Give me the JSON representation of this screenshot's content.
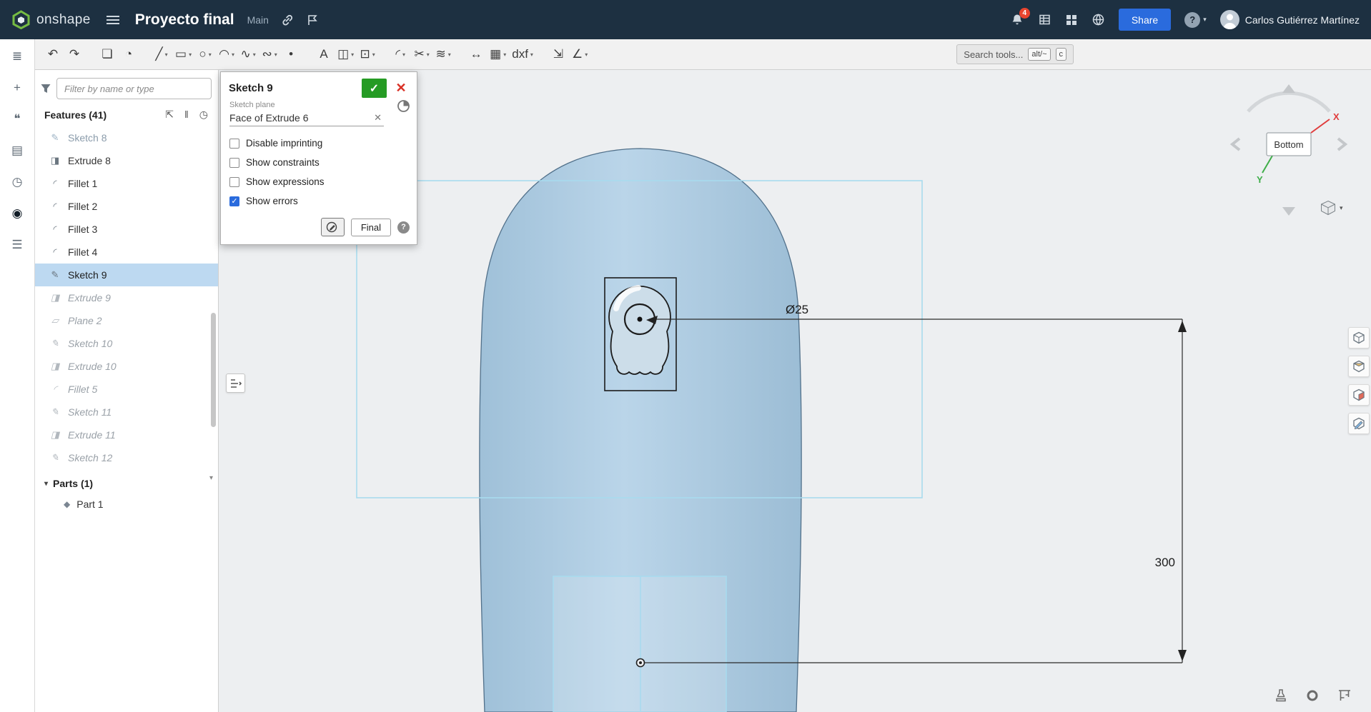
{
  "icons": {
    "caret": "▾",
    "check": "✓",
    "close": "✕",
    "hamburger": "☰",
    "question": "?"
  },
  "colors": {
    "topbar_bg": "#1d3041",
    "accent_blue": "#2a6bdd",
    "selection_blue": "#bdd9f1",
    "part_blue": "#aac9df",
    "sketch_line_blue": "#a8dbee",
    "success_green": "#259b24",
    "error_red": "#d93025",
    "logo_green": "#76bc43",
    "axis_x_red": "#e03c3c",
    "axis_y_green": "#3fae49"
  },
  "topbar": {
    "logo_text": "onshape",
    "document_title": "Proyecto final",
    "workspace_label": "Main",
    "notification_count": "4",
    "share_button": "Share",
    "user_name": "Carlos Gutiérrez Martínez"
  },
  "toolbar": {
    "search_text": "Search tools...",
    "kbd_alt": "alt/~",
    "kbd_c": "c",
    "items": [
      {
        "name": "undo-icon",
        "glyph": "↶"
      },
      {
        "name": "redo-icon",
        "glyph": "↷"
      },
      {
        "name": "paste-sketch-icon",
        "glyph": "❏",
        "cls": "gap"
      },
      {
        "name": "sketch-region-icon",
        "glyph": "◔"
      },
      {
        "name": "line-tool-icon",
        "glyph": "╱",
        "dd": true,
        "cls": "gap"
      },
      {
        "name": "rectangle-tool-icon",
        "glyph": "▭",
        "dd": true
      },
      {
        "name": "circle-tool-icon",
        "glyph": "○",
        "dd": true
      },
      {
        "name": "arc-tool-icon",
        "glyph": "◠",
        "dd": true
      },
      {
        "name": "spline-tool-icon",
        "glyph": "∿",
        "dd": true
      },
      {
        "name": "conic-tool-icon",
        "glyph": "∾",
        "dd": true
      },
      {
        "name": "point-tool-icon",
        "glyph": "•"
      },
      {
        "name": "text-tool-icon",
        "glyph": "A",
        "cls": "gap"
      },
      {
        "name": "mirror-tool-icon",
        "glyph": "◫",
        "dd": true
      },
      {
        "name": "project-convert-icon",
        "glyph": "⊡",
        "dd": true
      },
      {
        "name": "fillet-tool-icon",
        "glyph": "◜",
        "dd": true,
        "cls": "gap"
      },
      {
        "name": "trim-tool-icon",
        "glyph": "✂",
        "dd": true
      },
      {
        "name": "offset-tool-icon",
        "glyph": "≋",
        "dd": true
      },
      {
        "name": "dimension-tool-icon",
        "glyph": "↔",
        "cls": "gap"
      },
      {
        "name": "pattern-tool-icon",
        "glyph": "▦",
        "dd": true
      },
      {
        "name": "export-dxf-icon",
        "glyph": "dxf",
        "dd": true
      },
      {
        "name": "transform-tool-icon",
        "glyph": "⇲",
        "cls": "gap"
      },
      {
        "name": "measure-angle-icon",
        "glyph": "∠",
        "dd": true
      }
    ]
  },
  "left_strip": {
    "icons": [
      {
        "name": "features-panel-icon",
        "glyph": "≣"
      },
      {
        "name": "insert-panel-icon",
        "glyph": "+"
      },
      {
        "name": "comments-panel-icon",
        "glyph": "❝"
      },
      {
        "name": "notes-panel-icon",
        "glyph": "▤"
      },
      {
        "name": "history-panel-icon",
        "glyph": "◷"
      },
      {
        "name": "search-panel-icon",
        "glyph": "◉",
        "cls": "active"
      },
      {
        "name": "outline-panel-icon",
        "glyph": "☰"
      }
    ]
  },
  "sidebar": {
    "filter_placeholder": "Filter by name or type",
    "features_header": "Features (41)",
    "header_icons": [
      {
        "name": "final-marker-icon",
        "glyph": "⇱"
      },
      {
        "name": "suppress-icon",
        "glyph": "‖"
      },
      {
        "name": "history-icon",
        "glyph": "◷"
      }
    ],
    "features": [
      {
        "label": "Sketch 8",
        "icon": "sketch-icon",
        "glyph": "✎",
        "state": "dim"
      },
      {
        "label": "Extrude 8",
        "icon": "extrude-icon",
        "glyph": "◨",
        "state": "normal"
      },
      {
        "label": "Fillet 1",
        "icon": "fillet-icon",
        "glyph": "◜",
        "state": "normal"
      },
      {
        "label": "Fillet 2",
        "icon": "fillet-icon",
        "glyph": "◜",
        "state": "normal"
      },
      {
        "label": "Fillet 3",
        "icon": "fillet-icon",
        "glyph": "◜",
        "state": "normal"
      },
      {
        "label": "Fillet 4",
        "icon": "fillet-icon",
        "glyph": "◜",
        "state": "normal"
      },
      {
        "label": "Sketch 9",
        "icon": "sketch-icon",
        "glyph": "✎",
        "state": "selected"
      },
      {
        "label": "Extrude 9",
        "icon": "extrude-icon",
        "glyph": "◨",
        "state": "ghost"
      },
      {
        "label": "Plane 2",
        "icon": "plane-icon",
        "glyph": "▱",
        "state": "ghost"
      },
      {
        "label": "Sketch 10",
        "icon": "sketch-icon",
        "glyph": "✎",
        "state": "ghost"
      },
      {
        "label": "Extrude 10",
        "icon": "extrude-icon",
        "glyph": "◨",
        "state": "ghost"
      },
      {
        "label": "Fillet 5",
        "icon": "fillet-icon",
        "glyph": "◜",
        "state": "ghost"
      },
      {
        "label": "Sketch 11",
        "icon": "sketch-icon",
        "glyph": "✎",
        "state": "ghost"
      },
      {
        "label": "Extrude 11",
        "icon": "extrude-icon",
        "glyph": "◨",
        "state": "ghost"
      },
      {
        "label": "Sketch 12",
        "icon": "sketch-icon",
        "glyph": "✎",
        "state": "ghost"
      }
    ],
    "parts_header": "Parts (1)",
    "parts": [
      {
        "label": "Part 1",
        "icon": "part-icon",
        "glyph": "◆"
      }
    ]
  },
  "dialog": {
    "title": "Sketch 9",
    "plane_label": "Sketch plane",
    "plane_value": "Face of Extrude 6",
    "checkboxes": [
      {
        "label": "Disable imprinting",
        "checked": false
      },
      {
        "label": "Show constraints",
        "checked": false
      },
      {
        "label": "Show expressions",
        "checked": false
      },
      {
        "label": "Show errors",
        "checked": true
      }
    ],
    "final_button": "Final"
  },
  "canvas": {
    "sketch_label": "Sketch 9",
    "dim_diameter": "Ø25",
    "dim_length": "300",
    "view_orientation": "Bottom",
    "axis_x": "X",
    "axis_y": "Y",
    "right_tool_icons": [
      "view-modes-icon",
      "section-view-icon",
      "display-settings-icon",
      "edit-appearance-icon"
    ],
    "bottom_tool_icons": [
      "named-positions-icon",
      "orbit-icon",
      "measure-icon"
    ]
  }
}
